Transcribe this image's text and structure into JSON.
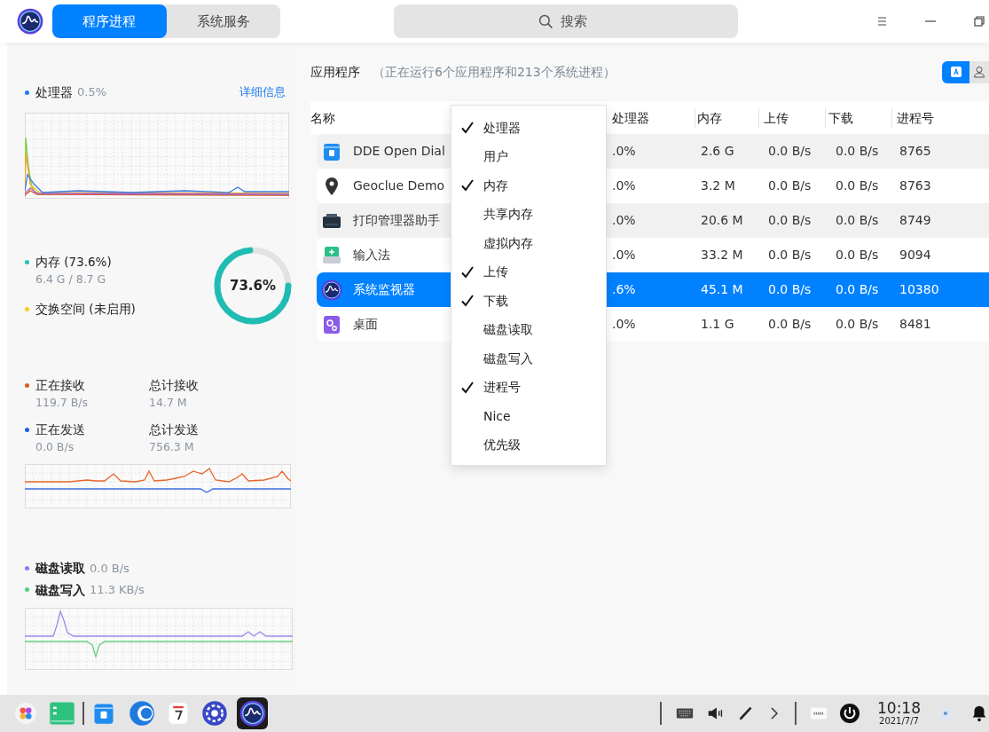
{
  "titlebar": {
    "tabs": [
      {
        "label": "程序进程",
        "selected": true
      },
      {
        "label": "系统服务",
        "selected": false
      }
    ],
    "search": {
      "placeholder": "搜索"
    }
  },
  "sidebar": {
    "cpu": {
      "label": "处理器",
      "value": "0.5%",
      "color": "#1a7cf0",
      "link": "详细信息"
    },
    "memory": {
      "items": [
        {
          "label": "内存 (73.6%)",
          "detail": "6.4 G / 8.7 G",
          "color": "#22c0b8"
        },
        {
          "label": "交换空间 (未启用)",
          "color": "#f4d21c"
        }
      ],
      "gauge": {
        "reading": "73.6%",
        "level": 0.736
      }
    },
    "network": {
      "items": [
        {
          "label": "正在接收",
          "value": "119.7 B/s",
          "total_label": "总计接收",
          "total": "14.7 M",
          "color": "#e55a1c"
        },
        {
          "label": "正在发送",
          "value": "0.0 B/s",
          "total_label": "总计发送",
          "total": "756.3 M",
          "color": "#1f5ce8"
        }
      ]
    },
    "disk": {
      "items": [
        {
          "label": "磁盘读取",
          "value": "0.0 B/s",
          "color": "#8d7cf0"
        },
        {
          "label": "磁盘写入",
          "value": "11.3 KB/s",
          "color": "#4fcf7a"
        }
      ]
    }
  },
  "processes": {
    "title": "应用程序",
    "summary": "（正在运行6个应用程序和213个系统进程）",
    "view_buttons": [
      {
        "selected": true
      },
      {
        "selected": false
      }
    ],
    "columns": [
      "名称",
      "处理器",
      "内存",
      "上传",
      "下载",
      "进程号"
    ],
    "rows": [
      {
        "name": "DDE Open Dial",
        "cpu": ".0%",
        "memory": "2.6 G",
        "upload": "0.0 B/s",
        "download": "0.0 B/s",
        "pid": "8765",
        "selected": false
      },
      {
        "name": "Geoclue Demo",
        "cpu": ".0%",
        "memory": "3.2 M",
        "upload": "0.0 B/s",
        "download": "0.0 B/s",
        "pid": "8763",
        "selected": false
      },
      {
        "name": "打印管理器助手",
        "cpu": ".0%",
        "memory": "20.6 M",
        "upload": "0.0 B/s",
        "download": "0.0 B/s",
        "pid": "8749",
        "selected": false
      },
      {
        "name": "输入法",
        "cpu": ".0%",
        "memory": "33.2 M",
        "upload": "0.0 B/s",
        "download": "0.0 B/s",
        "pid": "9094",
        "selected": false
      },
      {
        "name": "系统监视器",
        "cpu": ".6%",
        "memory": "45.1 M",
        "upload": "0.0 B/s",
        "download": "0.0 B/s",
        "pid": "10380",
        "selected": true
      },
      {
        "name": "桌面",
        "cpu": ".0%",
        "memory": "1.1 G",
        "upload": "0.0 B/s",
        "download": "0.0 B/s",
        "pid": "8481",
        "selected": false
      }
    ]
  },
  "column_menu": {
    "items": [
      {
        "label": "处理器",
        "checked": true
      },
      {
        "label": "用户",
        "checked": false
      },
      {
        "label": "内存",
        "checked": true
      },
      {
        "label": "共享内存",
        "checked": false
      },
      {
        "label": "虚拟内存",
        "checked": false
      },
      {
        "label": "上传",
        "checked": true
      },
      {
        "label": "下载",
        "checked": true
      },
      {
        "label": "磁盘读取",
        "checked": false
      },
      {
        "label": "磁盘写入",
        "checked": false
      },
      {
        "label": "进程号",
        "checked": true
      },
      {
        "label": "Nice",
        "checked": false
      },
      {
        "label": "优先级",
        "checked": false
      }
    ]
  },
  "taskbar": {
    "time": "10:18",
    "date": "2021/7/7"
  }
}
